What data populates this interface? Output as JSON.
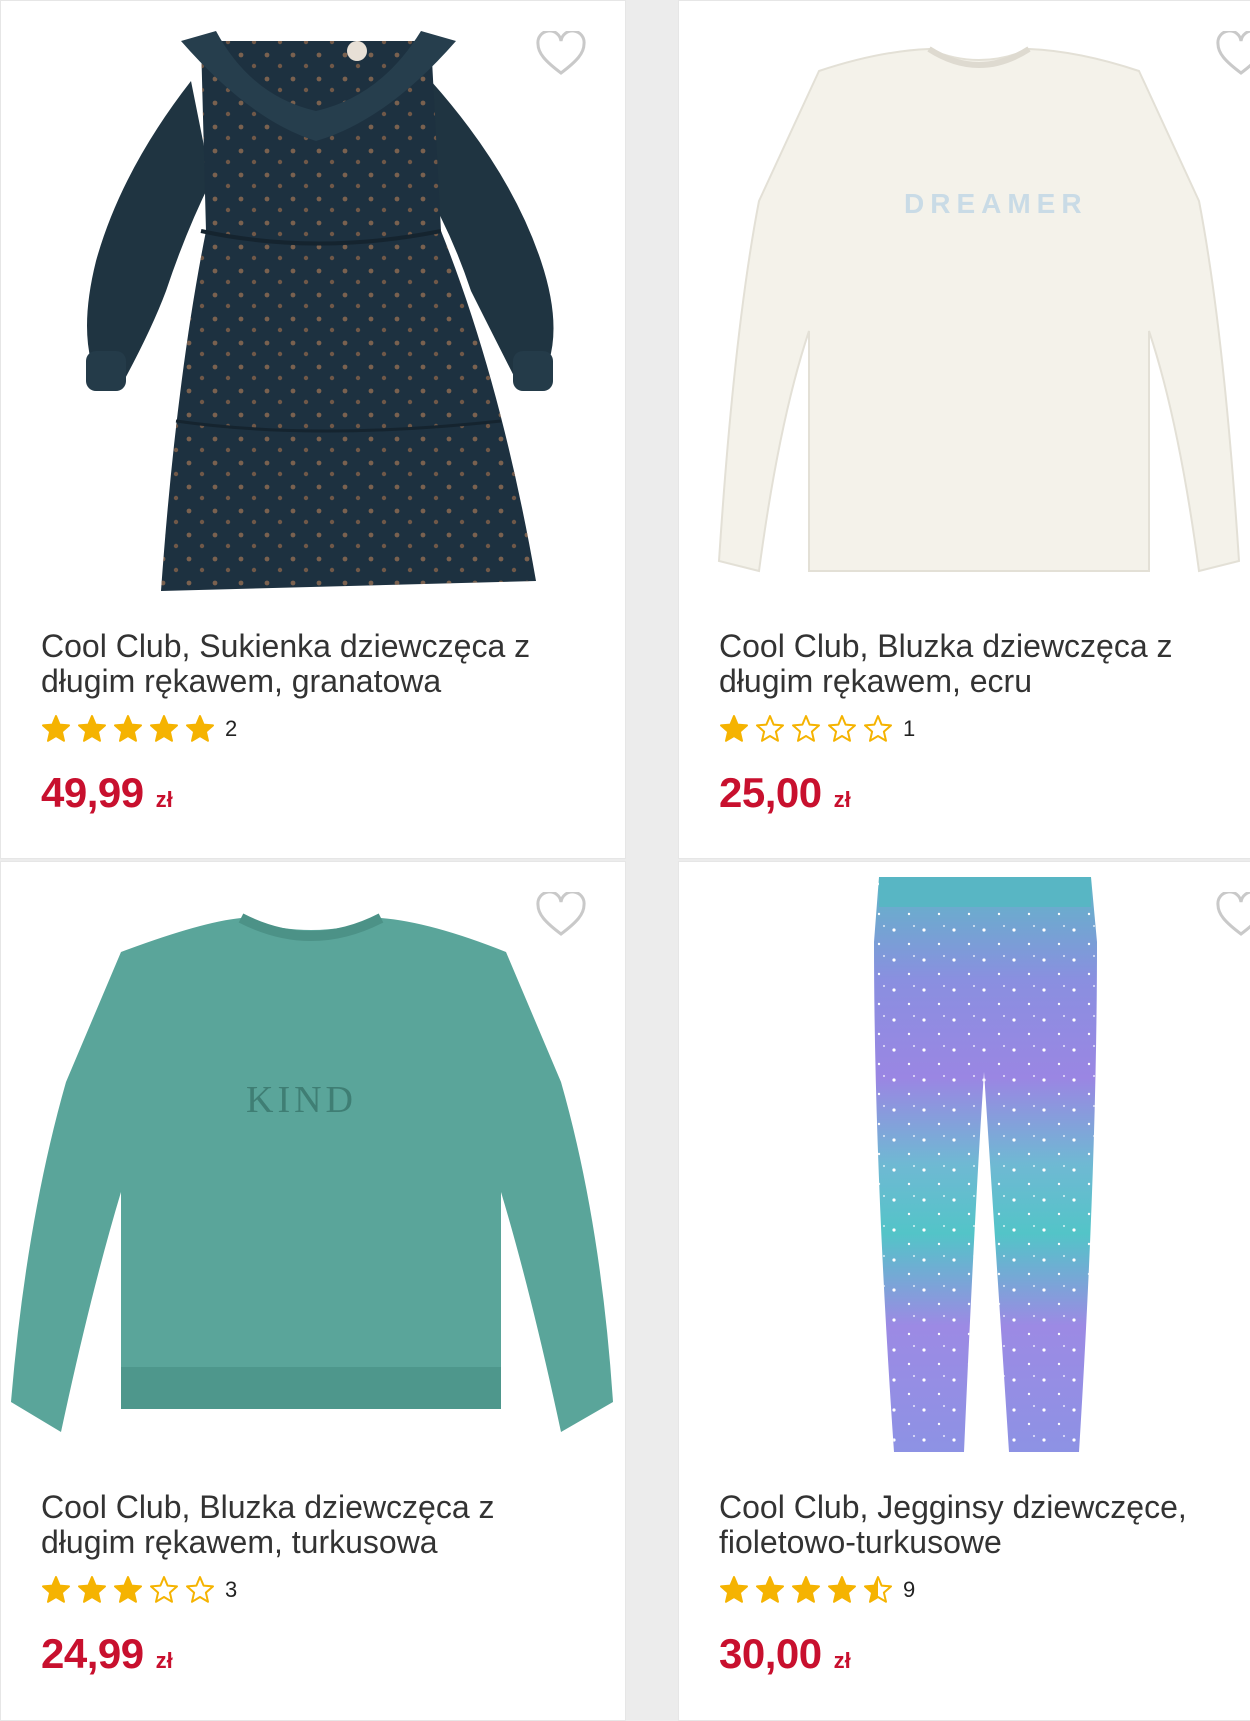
{
  "colors": {
    "price": "#c8102e",
    "star_filled": "#f5b301",
    "star_empty": "#f5b301",
    "heart": "#c9c9c9"
  },
  "products": [
    {
      "title": "Cool Club, Sukienka dziewczęca z długim rękawem, granatowa",
      "rating": 5,
      "rating_count": "2",
      "price": "49,99",
      "currency": "zł",
      "image": "navy-floral-dress",
      "wishlist_icon": "heart-outline-icon"
    },
    {
      "title": "Cool Club, Bluzka dziewczęca z długim rękawem, ecru",
      "rating": 1,
      "rating_count": "1",
      "price": "25,00",
      "currency": "zł",
      "image": "ecru-long-sleeve-top",
      "print_text": "DREAMER",
      "wishlist_icon": "heart-outline-icon"
    },
    {
      "title": "Cool Club, Bluzka dziewczęca z długim rękawem, turkusowa",
      "rating": 3,
      "rating_count": "3",
      "price": "24,99",
      "currency": "zł",
      "image": "turquoise-velour-sweatshirt",
      "print_text": "KIND",
      "wishlist_icon": "heart-outline-icon"
    },
    {
      "title": "Cool Club, Jegginsy dziewczęce, fioletowo-turkusowe",
      "rating": 4.5,
      "rating_count": "9",
      "price": "30,00",
      "currency": "zł",
      "image": "purple-turquoise-star-leggings",
      "wishlist_icon": "heart-outline-icon"
    }
  ]
}
